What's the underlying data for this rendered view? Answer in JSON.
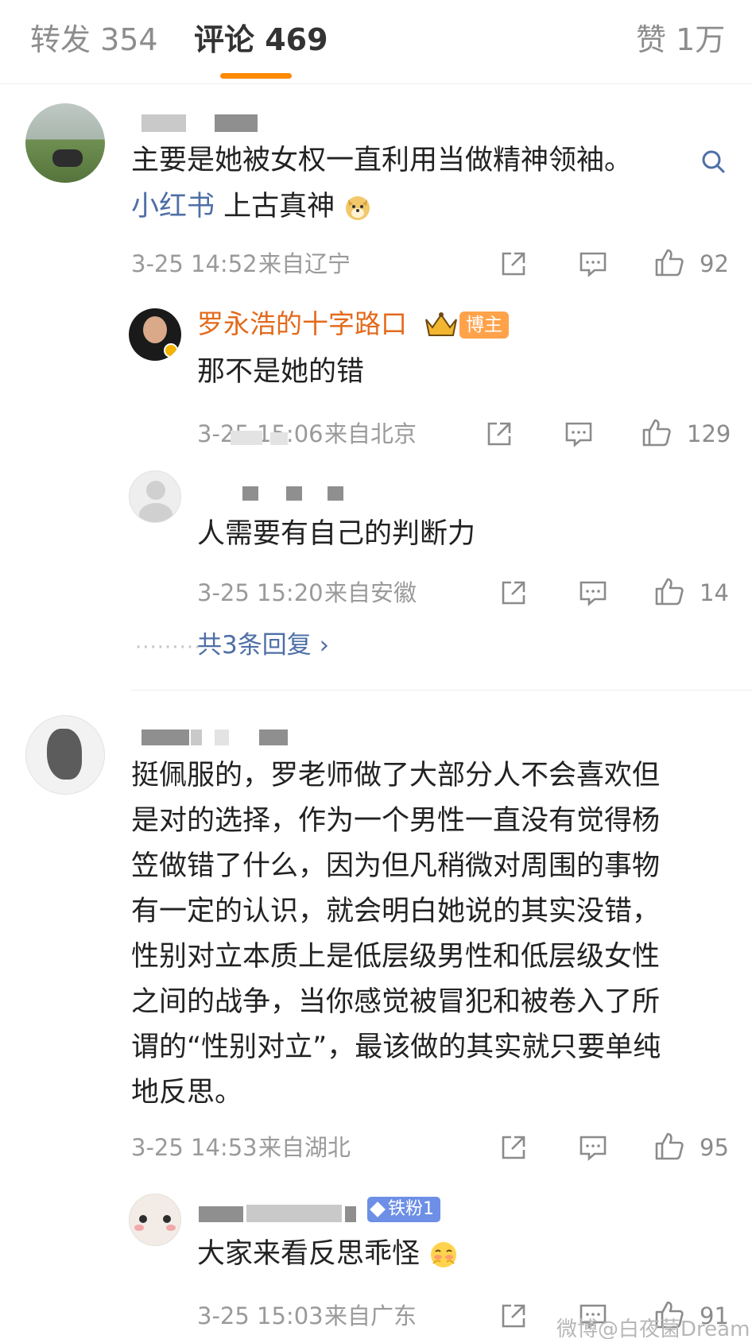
{
  "tabs": {
    "reposts": "转发 354",
    "comments": "评论 469",
    "likes": "赞 1万"
  },
  "comments": [
    {
      "text_main": "主要是她被女权一直利用当做精神领袖。",
      "link_text": "小红书",
      "text_tail": " 上古真神",
      "time": "3-25 14:52",
      "location": "来自辽宁",
      "likes": "92",
      "replies": [
        {
          "author": "罗永浩的十字路口",
          "badge": "博主",
          "text": "那不是她的错",
          "time": "3-25 15:06",
          "location": "来自北京",
          "likes": "129"
        },
        {
          "text": "人需要有自己的判断力",
          "time": "3-25 15:20",
          "location": "来自安徽",
          "likes": "14"
        }
      ],
      "more_replies": "共3条回复 ›"
    },
    {
      "lines": [
        "挺佩服的，罗老师做了大部分人不会喜欢但",
        "是对的选择，作为一个男性一直没有觉得杨",
        "笠做错了什么，因为但凡稍微对周围的事物",
        "有一定的认识，就会明白她说的其实没错，",
        "性别对立本质上是低层级男性和低层级女性",
        "之间的战争，当你感觉被冒犯和被卷入了所",
        "谓的“性别对立”，最该做的其实就只要单纯",
        "地反思。"
      ],
      "time": "3-25 14:53",
      "location": "来自湖北",
      "likes": "95",
      "replies": [
        {
          "badge": "铁粉1",
          "text": "大家来看反思乖怪",
          "time": "3-25 15:03",
          "location": "来自广东",
          "likes": "91"
        }
      ]
    }
  ],
  "watermark": "微博@白夜菌Dream",
  "colors": {
    "accent": "#ff8a00",
    "link": "#4e6fa6",
    "blogger_name": "#e36a1b",
    "badge_blogger": "#ffa24a",
    "badge_fan": "#6d8fe6"
  }
}
